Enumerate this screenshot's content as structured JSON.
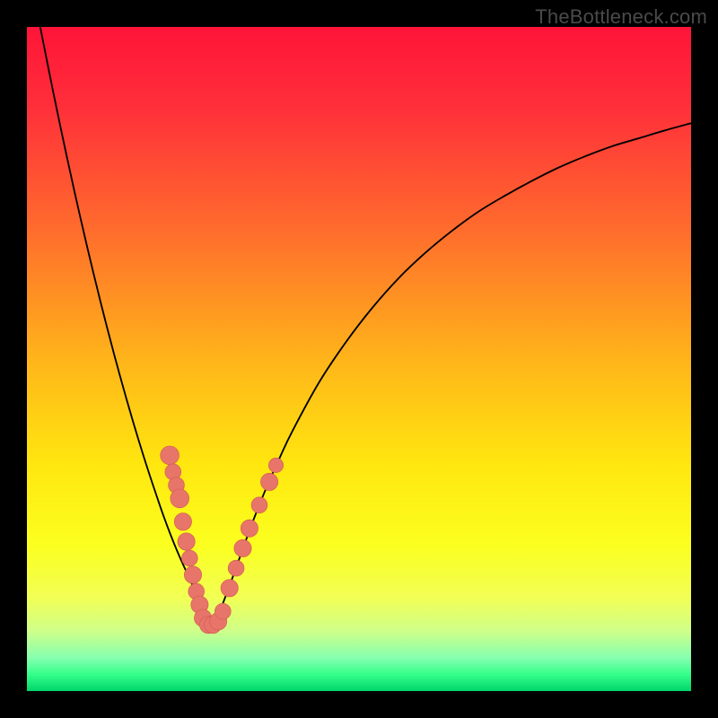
{
  "watermark": "TheBottleneck.com",
  "colors": {
    "frame": "#000000",
    "curve_stroke": "#000000",
    "marker_fill": "#e8756a",
    "marker_stroke": "#d55f55",
    "gradient_stops": [
      {
        "offset": 0.0,
        "color": "#ff1438"
      },
      {
        "offset": 0.12,
        "color": "#ff2f3a"
      },
      {
        "offset": 0.3,
        "color": "#ff6a2d"
      },
      {
        "offset": 0.5,
        "color": "#ffb41a"
      },
      {
        "offset": 0.66,
        "color": "#ffe70f"
      },
      {
        "offset": 0.78,
        "color": "#fbff1f"
      },
      {
        "offset": 0.86,
        "color": "#f1ff55"
      },
      {
        "offset": 0.91,
        "color": "#ceff8a"
      },
      {
        "offset": 0.95,
        "color": "#86ffaf"
      },
      {
        "offset": 0.975,
        "color": "#34ff8a"
      },
      {
        "offset": 1.0,
        "color": "#00d46a"
      }
    ]
  },
  "chart_data": {
    "type": "line",
    "title": "",
    "xlabel": "",
    "ylabel": "",
    "xlim": [
      0,
      100
    ],
    "ylim": [
      0,
      100
    ],
    "grid": false,
    "legend": false,
    "series": [
      {
        "name": "bottleneck-curve-left",
        "x": [
          2,
          4,
          6,
          8,
          10,
          12,
          14,
          16,
          18,
          20,
          21,
          22,
          23,
          24,
          25,
          26,
          27,
          28
        ],
        "values": [
          100,
          90,
          80.5,
          71.5,
          63,
          55,
          47.5,
          40.5,
          34,
          28,
          25.2,
          22.6,
          20.2,
          18,
          15.8,
          14,
          12,
          10.5
        ]
      },
      {
        "name": "bottleneck-curve-right",
        "x": [
          28,
          29,
          30,
          31,
          32,
          34,
          36,
          38,
          40,
          44,
          48,
          52,
          56,
          60,
          64,
          68,
          72,
          76,
          80,
          84,
          88,
          92,
          96,
          100
        ],
        "values": [
          10.5,
          12.0,
          14.5,
          17.2,
          20.0,
          25.5,
          30.5,
          35.0,
          39.2,
          46.5,
          52.5,
          57.7,
          62.2,
          66.0,
          69.3,
          72.2,
          74.6,
          76.8,
          78.8,
          80.5,
          82.0,
          83.2,
          84.4,
          85.5
        ]
      }
    ],
    "markers": [
      {
        "x": 21.5,
        "y": 35.5,
        "r": 1.4
      },
      {
        "x": 22.0,
        "y": 33.0,
        "r": 1.2
      },
      {
        "x": 22.5,
        "y": 31.0,
        "r": 1.2
      },
      {
        "x": 23.0,
        "y": 29.0,
        "r": 1.4
      },
      {
        "x": 23.5,
        "y": 25.5,
        "r": 1.3
      },
      {
        "x": 24.0,
        "y": 22.5,
        "r": 1.3
      },
      {
        "x": 24.5,
        "y": 20.0,
        "r": 1.2
      },
      {
        "x": 25.0,
        "y": 17.5,
        "r": 1.3
      },
      {
        "x": 25.5,
        "y": 15.0,
        "r": 1.2
      },
      {
        "x": 26.0,
        "y": 13.0,
        "r": 1.3
      },
      {
        "x": 26.5,
        "y": 11.0,
        "r": 1.3
      },
      {
        "x": 27.3,
        "y": 10.0,
        "r": 1.3
      },
      {
        "x": 28.0,
        "y": 10.0,
        "r": 1.3
      },
      {
        "x": 28.8,
        "y": 10.5,
        "r": 1.3
      },
      {
        "x": 29.5,
        "y": 12.0,
        "r": 1.2
      },
      {
        "x": 30.5,
        "y": 15.5,
        "r": 1.3
      },
      {
        "x": 31.5,
        "y": 18.5,
        "r": 1.2
      },
      {
        "x": 32.5,
        "y": 21.5,
        "r": 1.3
      },
      {
        "x": 33.5,
        "y": 24.5,
        "r": 1.3
      },
      {
        "x": 35.0,
        "y": 28.0,
        "r": 1.2
      },
      {
        "x": 36.5,
        "y": 31.5,
        "r": 1.3
      },
      {
        "x": 37.5,
        "y": 34.0,
        "r": 1.1
      }
    ]
  }
}
